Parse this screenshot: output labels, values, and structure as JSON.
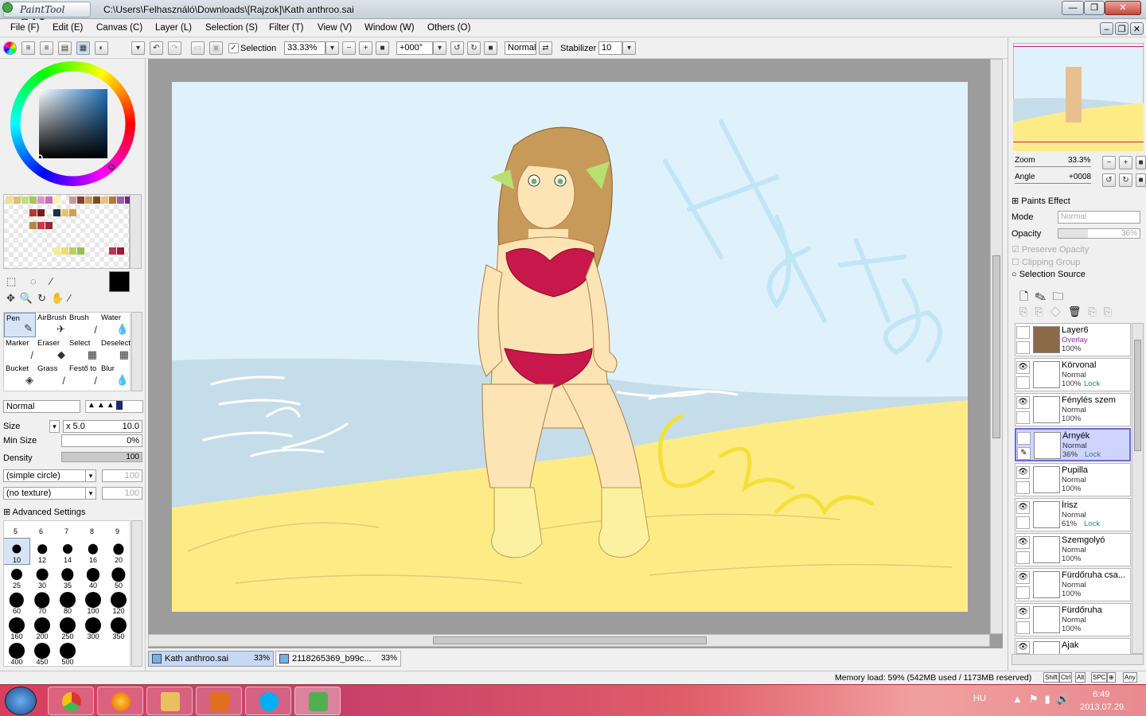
{
  "app": {
    "logo_text": "PaintTool",
    "logo_bold": "SAI",
    "window_title": "C:\\Users\\Felhasználó\\Downloads\\[Rajzok]\\Kath anthroo.sai"
  },
  "menu": [
    "File (F)",
    "Edit (E)",
    "Canvas (C)",
    "Layer (L)",
    "Selection (S)",
    "Filter (T)",
    "View (V)",
    "Window (W)",
    "Others (O)"
  ],
  "toolbar": {
    "selection_label": "Selection",
    "zoom": "33.33%",
    "rotation": "+000°",
    "blend_mode": "Normal",
    "stabilizer_label": "Stabilizer",
    "stabilizer_value": "10"
  },
  "tools": [
    {
      "label": "Pen",
      "glyph": "✎"
    },
    {
      "label": "AirBrush",
      "glyph": "✈"
    },
    {
      "label": "Brush",
      "glyph": "/"
    },
    {
      "label": "Water",
      "glyph": "💧"
    },
    {
      "label": "Marker",
      "glyph": "/"
    },
    {
      "label": "Eraser",
      "glyph": "◆"
    },
    {
      "label": "Select",
      "glyph": "▦"
    },
    {
      "label": "Deselect",
      "glyph": "▦"
    },
    {
      "label": "Bucket",
      "glyph": "◈"
    },
    {
      "label": "Grass",
      "glyph": "/"
    },
    {
      "label": "Festő to",
      "glyph": "/"
    },
    {
      "label": "Blur",
      "glyph": "💧"
    }
  ],
  "brush_settings": {
    "mode": "Normal",
    "size_label": "Size",
    "size_multiplier": "x 5.0",
    "size_value": "10.0",
    "min_size_label": "Min Size",
    "min_size_value": "0%",
    "density_label": "Density",
    "density_value": "100",
    "shape": "(simple circle)",
    "shape_value": "100",
    "texture": "(no texture)",
    "texture_value": "100",
    "advanced": "Advanced Settings"
  },
  "brush_sizes_top": [
    "5",
    "6",
    "7",
    "8",
    "9"
  ],
  "brush_sizes": [
    "10",
    "12",
    "14",
    "16",
    "20",
    "25",
    "30",
    "35",
    "40",
    "50",
    "60",
    "70",
    "80",
    "100",
    "120",
    "160",
    "200",
    "250",
    "300",
    "350",
    "400",
    "450",
    "500"
  ],
  "colors": {
    "primary": "#000000",
    "secondary": "#ffffff",
    "swatches": [
      "#f2dc8f",
      "#d9c26f",
      "#bfe07a",
      "#a7c65a",
      "#e58fc8",
      "#c471b4",
      "#f8f3b0",
      "#ffffff",
      "#c79a9a",
      "#8c3a3a",
      "#c9a05a",
      "#7b4b1e",
      "#e7c088",
      "#b07a38",
      "#9a5fa8",
      "#6b2c7a",
      "#ffffff",
      "#ffffff",
      "#ffffff",
      "#b43a2a",
      "#7a1b1b",
      "#ffffff",
      "#1b3040",
      "#e8c070",
      "#d0a050",
      "#ffffff",
      "#ffffff",
      "#ffffff",
      "#ffffff",
      "#ffffff",
      "#ffffff",
      "#ffffff",
      "#ffffff",
      "#ffffff",
      "#ffffff",
      "#b08848",
      "#c43c3c",
      "#9a2a2a",
      "#ffffff",
      "#ffffff",
      "#ffffff",
      "#ffffff",
      "#ffffff",
      "#ffffff",
      "#ffffff",
      "#ffffff",
      "#ffffff",
      "#ffffff",
      "#ffffff",
      "#ffffff",
      "#ffffff",
      "#ffffff",
      "#ffffff",
      "#ffffff",
      "#ffffff",
      "#ffffff",
      "#ffffff",
      "#ffffff",
      "#ffffff",
      "#ffffff",
      "#ffffff",
      "#ffffff",
      "#ffffff",
      "#ffffff",
      "#ffffff",
      "#ffffff",
      "#ffffff",
      "#ffffff",
      "#ffffff",
      "#ffffff",
      "#f4ec90",
      "#e8dc78",
      "#b8d060",
      "#98c050",
      "#ffffff",
      "#ffffff",
      "#ffffff",
      "#c43050",
      "#a01838",
      "#ffffff"
    ]
  },
  "navigator": {
    "zoom_label": "Zoom",
    "zoom_value": "33.3%",
    "angle_label": "Angle",
    "angle_value": "+0008"
  },
  "layer_panel": {
    "effect": "Paints Effect",
    "mode_label": "Mode",
    "mode_value": "Normal",
    "opacity_label": "Opacity",
    "opacity_value": "36%",
    "preserve_opacity": "Preserve Opacity",
    "clipping_group": "Clipping Group",
    "selection_source": "Selection Source"
  },
  "layers": [
    {
      "name": "Layer6",
      "mode": "Overlay",
      "opacity": "100%",
      "lock": "",
      "visible": false,
      "thumb": "#8b6a48"
    },
    {
      "name": "Körvonal",
      "mode": "Normal",
      "opacity": "100%",
      "lock": "Lock",
      "visible": true,
      "thumb": "#ffffff"
    },
    {
      "name": "Fénylés szem",
      "mode": "Normal",
      "opacity": "100%",
      "lock": "",
      "visible": true,
      "thumb": "#ffffff"
    },
    {
      "name": "Árnyék",
      "mode": "Normal",
      "opacity": "36%",
      "lock": "Lock",
      "visible": false,
      "thumb": "#ffffff"
    },
    {
      "name": "Pupilla",
      "mode": "Normal",
      "opacity": "100%",
      "lock": "",
      "visible": true,
      "thumb": "#ffffff"
    },
    {
      "name": "Írisz",
      "mode": "Normal",
      "opacity": "61%",
      "lock": "Lock",
      "visible": true,
      "thumb": "#ffffff"
    },
    {
      "name": "Szemgolyó",
      "mode": "Normal",
      "opacity": "100%",
      "lock": "",
      "visible": true,
      "thumb": "#ffffff"
    },
    {
      "name": "Fürdőruha csa...",
      "mode": "Normal",
      "opacity": "100%",
      "lock": "",
      "visible": true,
      "thumb": "#ffffff"
    },
    {
      "name": "Fürdőruha",
      "mode": "Normal",
      "opacity": "100%",
      "lock": "",
      "visible": true,
      "thumb": "#ffffff"
    },
    {
      "name": "Ajak",
      "mode": "",
      "opacity": "",
      "lock": "",
      "visible": true,
      "thumb": "#ffffff"
    }
  ],
  "doc_tabs": [
    {
      "name": "Kath anthroo.sai",
      "zoom": "33%"
    },
    {
      "name": "2118265369_b99c...",
      "zoom": "33%"
    }
  ],
  "status": {
    "memory": "Memory load: 59% (542MB used / 1173MB reserved)",
    "keys": [
      "Shift",
      "Ctrl",
      "Alt",
      "SPC",
      "⊕",
      "Any"
    ]
  },
  "taskbar": {
    "lang": "HU",
    "time": "6:49",
    "date": "2013.07.29."
  }
}
